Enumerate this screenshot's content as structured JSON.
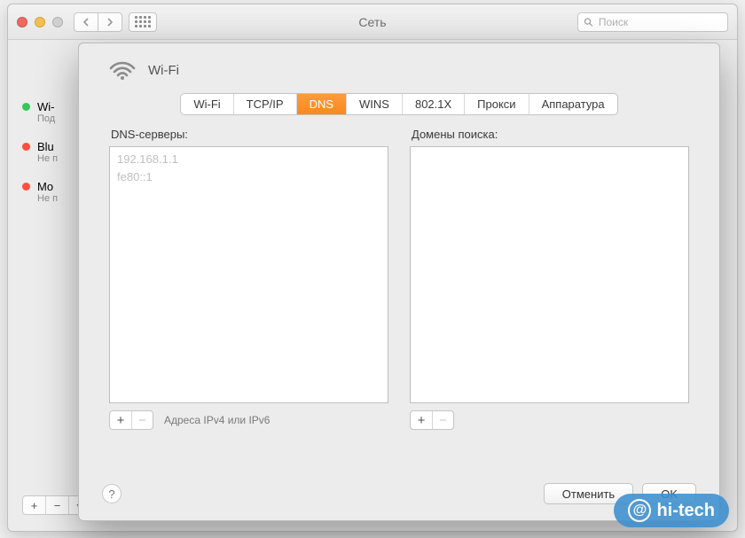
{
  "window": {
    "title": "Сеть",
    "search_placeholder": "Поиск"
  },
  "sidebar": {
    "items": [
      {
        "name": "Wi-",
        "status": "Под",
        "dot": "green"
      },
      {
        "name": "Blu",
        "status": "Не п",
        "dot": "red"
      },
      {
        "name": "Mo",
        "status": "Не п",
        "dot": "red"
      }
    ]
  },
  "sheet": {
    "title": "Wi-Fi",
    "tabs": [
      "Wi-Fi",
      "TCP/IP",
      "DNS",
      "WINS",
      "802.1X",
      "Прокси",
      "Аппаратура"
    ],
    "active_tab": 2,
    "dns": {
      "label": "DNS-серверы:",
      "entries": [
        "192.168.1.1",
        "fe80::1"
      ],
      "hint": "Адреса IPv4 или IPv6"
    },
    "search_domains": {
      "label": "Домены поиска:",
      "entries": []
    },
    "buttons": {
      "cancel": "Отменить",
      "ok": "OK"
    }
  },
  "watermark": "hi-tech"
}
